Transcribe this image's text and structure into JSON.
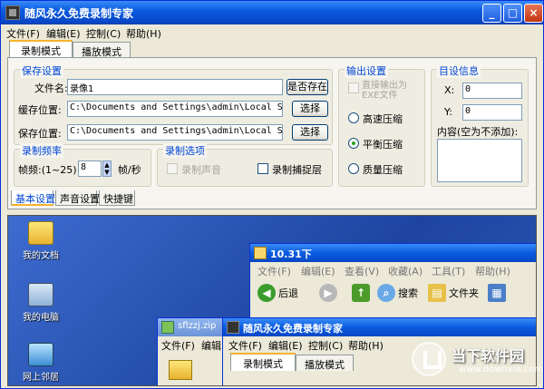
{
  "window": {
    "title": "随风永久免费录制专家",
    "min_label": "_",
    "max_label": "□",
    "close_label": "×"
  },
  "menu": [
    "文件(F)",
    "编辑(E)",
    "控制(C)",
    "帮助(H)"
  ],
  "mode_tabs": [
    "录制模式",
    "播放模式"
  ],
  "save_group": {
    "label": "保存设置",
    "filename_label": "文件名:",
    "filename_value": "录像1",
    "exists_button": "是否存在",
    "cache_label": "缓存位置:",
    "cache_value": "C:\\Documents and Settings\\admin\\Local Settings\\T",
    "save_label": "保存位置:",
    "save_value": "C:\\Documents and Settings\\admin\\Local Settings\\T",
    "browse_button": "选择"
  },
  "output_group": {
    "label": "输出设置",
    "direct_exe": "直接输出为EXE文件",
    "options": [
      "高速压缩",
      "平衡压缩",
      "质量压缩"
    ],
    "selected": "平衡压缩"
  },
  "target_group": {
    "label": "目设信息",
    "x_label": "X:",
    "x_value": "0",
    "y_label": "Y:",
    "y_value": "0",
    "content_label": "内容(空为不添加):"
  },
  "freq_group": {
    "label": "录制频率",
    "fps_label": "帧频:(1~25)",
    "fps_value": "8",
    "fps_unit": "帧/秒"
  },
  "rec_group": {
    "label": "录制选项",
    "record_sound": "录制声音",
    "record_cursor": "录制捕捉层"
  },
  "bottom_tabs": [
    "基本设置",
    "声音设置",
    "快捷键"
  ],
  "desktop": {
    "icons": [
      "我的文档",
      "我的电脑",
      "网上邻居"
    ],
    "explorer": {
      "title": "10.31下",
      "menu": [
        "文件(F)",
        "编辑(E)",
        "查看(V)",
        "收藏(A)",
        "工具(T)",
        "帮助(H)"
      ],
      "back": "后退",
      "search": "搜索",
      "folders": "文件夹"
    },
    "zip_title": "sflzzj.zip",
    "zip_menu": [
      "文件(F)",
      "编辑"
    ],
    "nested": {
      "title": "随风永久免费录制专家",
      "menu": [
        "文件(F)",
        "编辑(E)",
        "控制(C)",
        "帮助(H)"
      ],
      "tabs": [
        "录制模式",
        "播放模式"
      ]
    }
  },
  "watermark": {
    "brand": "当下软件园",
    "url": "www.downxia.com"
  }
}
